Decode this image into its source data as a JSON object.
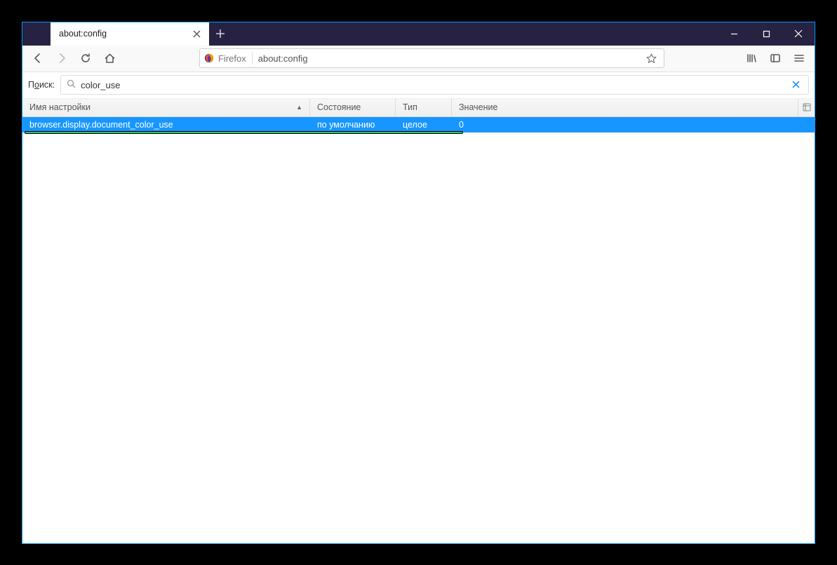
{
  "window": {
    "tab_title": "about:config"
  },
  "nav": {
    "identity_host": "Firefox",
    "url": "about:config"
  },
  "search": {
    "label_pre": "П",
    "label_u": "о",
    "label_post": "иск:",
    "value": "color_use"
  },
  "columns": {
    "name": "Имя настройки",
    "state": "Состояние",
    "type": "Тип",
    "value": "Значение"
  },
  "rows": [
    {
      "name": "browser.display.document_color_use",
      "state": "по умолчанию",
      "type": "целое",
      "value": "0",
      "selected": true
    }
  ]
}
